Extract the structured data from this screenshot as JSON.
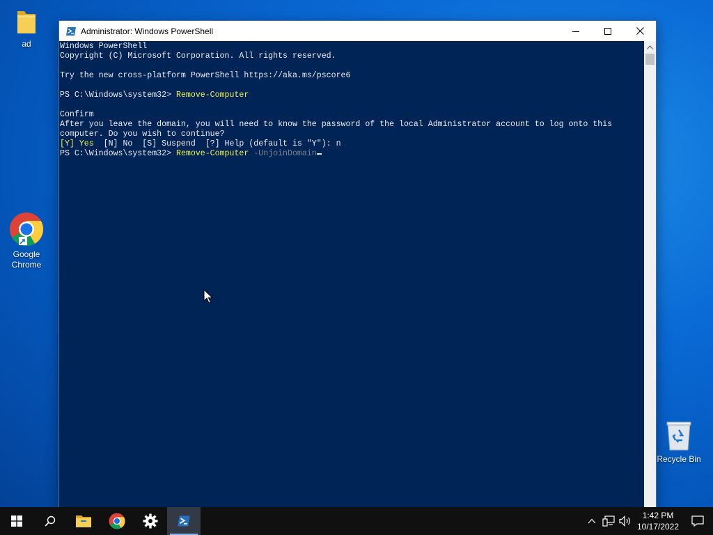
{
  "desktop": {
    "icons": [
      {
        "label": "ad"
      },
      {
        "label": "Google Chrome"
      },
      {
        "label": "Recycle Bin"
      }
    ]
  },
  "window": {
    "title": "Administrator: Windows PowerShell",
    "console": {
      "line1": "Windows PowerShell",
      "line2": "Copyright (C) Microsoft Corporation. All rights reserved.",
      "line3": "",
      "line4": "Try the new cross-platform PowerShell https://aka.ms/pscore6",
      "line5": "",
      "prompt": "PS C:\\Windows\\system32> ",
      "cmd1": "Remove-Computer",
      "line7": "",
      "line8": "Confirm",
      "line9": "After you leave the domain, you will need to know the password of the local Administrator account to log onto this",
      "line10": "computer. Do you wish to continue?",
      "choice_yes": "[Y] Yes",
      "choice_rest": "  [N] No  [S] Suspend  [?] Help (default is \"Y\"): n",
      "cmd2": "Remove-Computer",
      "cmd2_param": " -UnjoinDomain"
    }
  },
  "taskbar": {
    "clock_time": "1:42 PM",
    "clock_date": "10/17/2022"
  },
  "colors": {
    "console_bg": "#012456",
    "console_fg": "#eeedf0",
    "command_yellow": "#f1f14d",
    "param_gray": "#7d8593"
  }
}
